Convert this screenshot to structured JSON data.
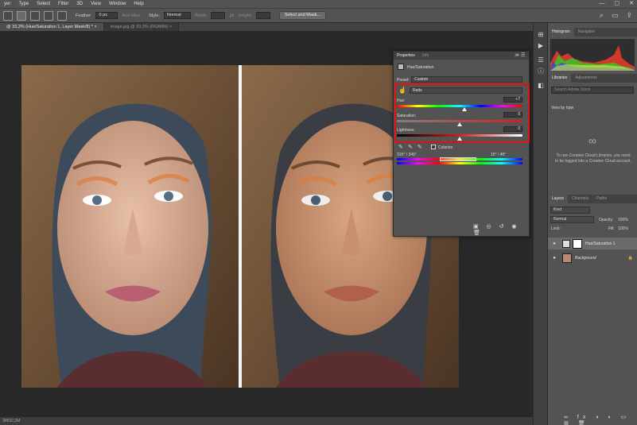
{
  "menu": [
    "yer",
    "Type",
    "Select",
    "Filter",
    "3D",
    "View",
    "Window",
    "Help"
  ],
  "window_controls": [
    "—",
    "▢",
    "✕"
  ],
  "options_bar": {
    "feather_label": "Feather:",
    "feather_value": "0 px",
    "anti_alias": "Anti-alias",
    "style_label": "Style:",
    "style_value": "Normal",
    "width_label": "Width:",
    "height_label": "Height:",
    "select_mask_button": "Select and Mask..."
  },
  "tabs": [
    {
      "label": "@ 33,3% (Hue/Saturation 1, Layer Mask/8) *"
    },
    {
      "label": "image.jpg @ 33,3% (RGB/8#)"
    }
  ],
  "status": "3M/32,2M",
  "properties": {
    "tab_properties": "Properties",
    "tab_info": "Info",
    "adjustment_title": "Hue/Saturation",
    "preset_label": "Preset:",
    "preset_value": "Custom",
    "channel_value": "Reds",
    "hue_label": "Hue:",
    "hue_value": "+7",
    "hue_pct": 0.54,
    "saturation_label": "Saturation:",
    "saturation_value": "0",
    "saturation_pct": 0.5,
    "lightness_label": "Lightness:",
    "lightness_value": "0",
    "lightness_pct": 0.5,
    "colorize_label": "Colorize",
    "range_left": "315° / 345°",
    "range_right": "15° \\ 45°"
  },
  "histogram": {
    "tab_histogram": "Histogram",
    "tab_navigator": "Navigator"
  },
  "libraries": {
    "tab_libraries": "Libraries",
    "tab_adjustments": "Adjustments",
    "search_placeholder": "Search Adobe Stock",
    "view_by": "View by type",
    "message": "To use Creative Cloud Libraries, you need to be logged into a Creative Cloud account."
  },
  "layers": {
    "tab_layers": "Layers",
    "tab_channels": "Channels",
    "tab_paths": "Paths",
    "kind": "Kind",
    "blend_mode": "Normal",
    "opacity_label": "Opacity:",
    "opacity_value": "100%",
    "lock_label": "Lock:",
    "fill_label": "Fill:",
    "fill_value": "100%",
    "items": [
      {
        "name": "Hue/Saturation 1"
      },
      {
        "name": "Background"
      }
    ]
  }
}
